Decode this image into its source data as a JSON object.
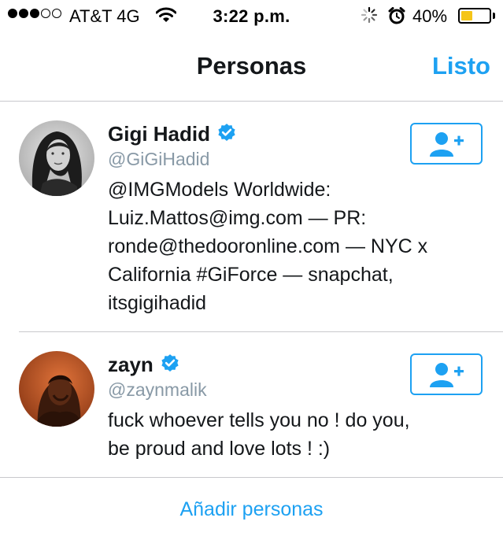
{
  "status_bar": {
    "carrier": "AT&T 4G",
    "time": "3:22 p.m.",
    "battery_percent": "40%",
    "battery_level": 0.4,
    "signal_bars_filled": 3,
    "signal_bars_total": 5
  },
  "nav": {
    "title": "Personas",
    "done_label": "Listo"
  },
  "users": [
    {
      "name": "Gigi Hadid",
      "handle": "@GiGiHadid",
      "verified": true,
      "bio_lines": [
        "@IMGModels Worldwide:",
        "Luiz.Mattos@img.com — PR:",
        "ronde@thedooronline.com — NYC x",
        "California #GiForce — snapchat,",
        "itsgigihadid"
      ]
    },
    {
      "name": "zayn",
      "handle": "@zaynmalik",
      "verified": true,
      "bio_lines": [
        "fuck whoever tells you no ! do you,",
        "be proud and love lots ! :)"
      ]
    }
  ],
  "footer": {
    "add_people_label": "Añadir personas"
  },
  "colors": {
    "accent": "#1da1f2",
    "secondary_text": "#8899a6",
    "battery_fill": "#f5c518"
  },
  "icons": {
    "follow": "add-user-icon",
    "verified": "verified-badge-icon"
  }
}
